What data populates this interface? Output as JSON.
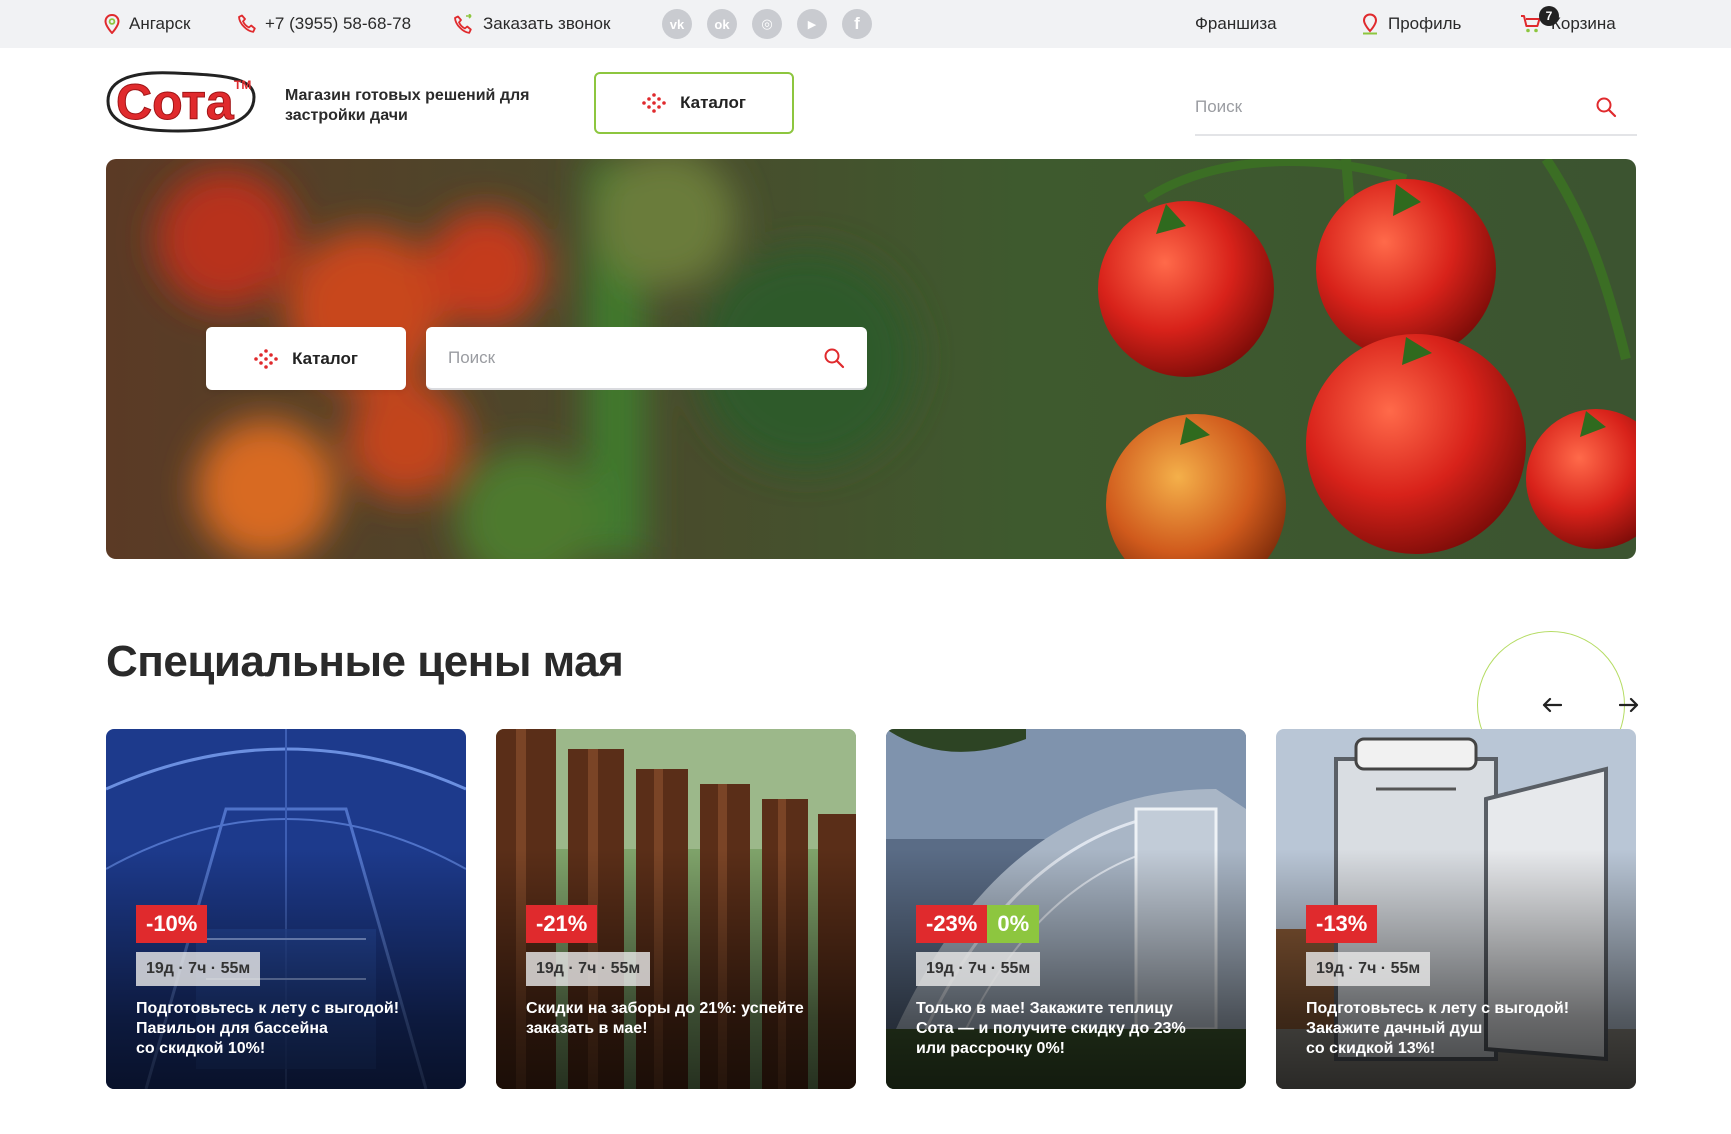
{
  "topbar": {
    "city": "Ангарск",
    "phone": "+7 (3955) 58-68-78",
    "callback": "Заказать звонок",
    "socials": [
      {
        "icon": "vk-icon",
        "glyph": "vk"
      },
      {
        "icon": "ok-icon",
        "glyph": "ok"
      },
      {
        "icon": "instagram-icon",
        "glyph": "◎"
      },
      {
        "icon": "youtube-icon",
        "glyph": "▶"
      },
      {
        "icon": "facebook-icon",
        "glyph": "f"
      }
    ],
    "franchise": "Франшиза",
    "profile": "Профиль",
    "cart": "Корзина",
    "cart_count": "7"
  },
  "header": {
    "logo_text": "Сота",
    "logo_tm": "TM",
    "tagline": "Магазин готовых решений для застройки дачи",
    "catalog_label": "Каталог",
    "search_placeholder": "Поиск"
  },
  "hero": {
    "catalog_label": "Каталог",
    "search_placeholder": "Поиск"
  },
  "section": {
    "title": "Специальные цены мая"
  },
  "cards": [
    {
      "discount": "-10%",
      "extra_badge": "",
      "timer": "19д · 7ч · 55м",
      "text": "Подготовьтесь к лету с выгодой!\nПавильон для бассейна\nсо скидкой 10%!"
    },
    {
      "discount": "-21%",
      "extra_badge": "",
      "timer": "19д · 7ч · 55м",
      "text": "Скидки на заборы до 21%: успейте\nзаказать в мае!"
    },
    {
      "discount": "-23%",
      "extra_badge": "0%",
      "timer": "19д · 7ч · 55м",
      "text": "Только в мае! Закажите теплицу\nСота — и получите скидку до 23%\nили рассрочку 0%!"
    },
    {
      "discount": "-13%",
      "extra_badge": "",
      "timer": "19д · 7ч · 55м",
      "text": "Подготовьтесь к лету с выгодой!\nЗакажите дачный душ\nсо скидкой 13%!"
    }
  ],
  "colors": {
    "brand_red": "#e02a2d",
    "brand_green": "#8dc63f",
    "topbar_bg": "#f1f2f4"
  }
}
